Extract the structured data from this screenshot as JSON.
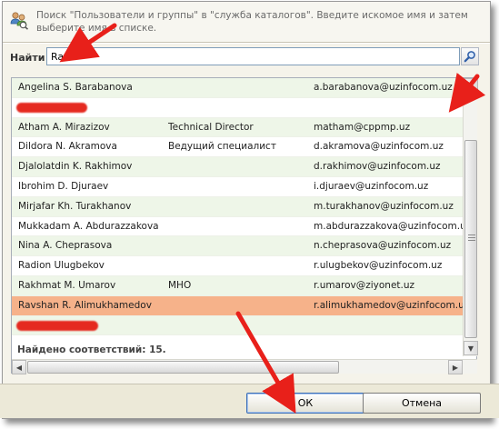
{
  "header": {
    "text": "Поиск \"Пользователи и группы\" в \"служба каталогов\". Введите искомое имя и затем выберите имя в списке."
  },
  "search": {
    "label": "Найти",
    "value": "Ra"
  },
  "results": {
    "rows": [
      {
        "name": "Angelina S. Barabanova",
        "title": "",
        "email": "a.barabanova@uzinfocom.uz",
        "redacted": false,
        "style": "alt"
      },
      {
        "name": "",
        "title": "",
        "email": "",
        "redacted": true,
        "style": "plain"
      },
      {
        "name": "Atham A. Mirazizov",
        "title": "Technical Director",
        "email": "matham@cppmp.uz",
        "redacted": false,
        "style": "alt"
      },
      {
        "name": "Dildora N. Akramova",
        "title": "Ведущий специалист",
        "email": "d.akramova@uzinfocom.uz",
        "redacted": false,
        "style": "plain"
      },
      {
        "name": "Djalolatdin K. Rakhimov",
        "title": "",
        "email": "d.rakhimov@uzinfocom.uz",
        "redacted": false,
        "style": "alt"
      },
      {
        "name": "Ibrohim D. Djuraev",
        "title": "",
        "email": "i.djuraev@uzinfocom.uz",
        "redacted": false,
        "style": "plain"
      },
      {
        "name": "Mirjafar Kh. Turakhanov",
        "title": "",
        "email": "m.turakhanov@uzinfocom.uz",
        "redacted": false,
        "style": "alt"
      },
      {
        "name": "Mukkadam A. Abdurazzakova",
        "title": "",
        "email": "m.abdurazzakova@uzinfocom.uz",
        "redacted": false,
        "style": "plain"
      },
      {
        "name": "Nina A. Cheprasova",
        "title": "",
        "email": "n.cheprasova@uzinfocom.uz",
        "redacted": false,
        "style": "alt"
      },
      {
        "name": "Radion Ulugbekov",
        "title": "",
        "email": "r.ulugbekov@uzinfocom.uz",
        "redacted": false,
        "style": "plain"
      },
      {
        "name": "Rakhmat M. Umarov",
        "title": "MHO",
        "email": "r.umarov@ziyonet.uz",
        "redacted": false,
        "style": "alt"
      },
      {
        "name": "Ravshan R. Alimukhamedov",
        "title": "",
        "email": "r.alimukhamedov@uzinfocom.uz",
        "redacted": false,
        "style": "selected"
      },
      {
        "name": "",
        "title": "",
        "email": "",
        "redacted": true,
        "style": "alt"
      }
    ],
    "summary": "Найдено соответствий: 15."
  },
  "buttons": {
    "ok": "ОК",
    "cancel": "Отмена"
  },
  "colors": {
    "selected_row": "#f6b28a",
    "alt_row": "#eef6e8",
    "annotation_arrow": "#e8201a"
  }
}
